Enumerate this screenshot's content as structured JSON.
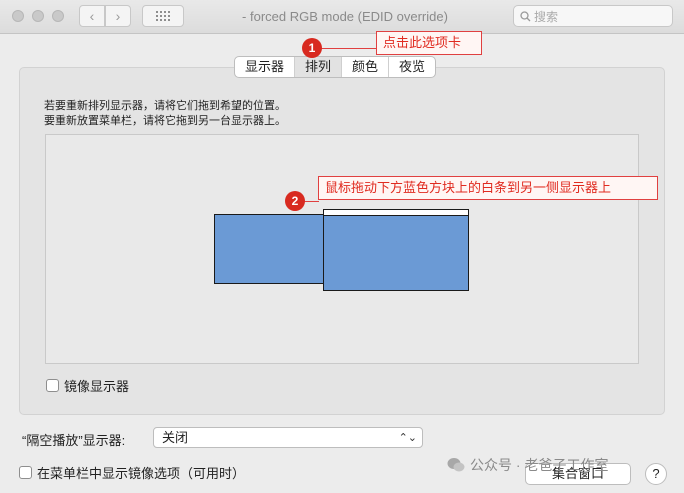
{
  "window": {
    "title": "- forced RGB mode (EDID override)",
    "search_placeholder": "搜索"
  },
  "tabs": [
    {
      "label": "显示器"
    },
    {
      "label": "排列",
      "active": true
    },
    {
      "label": "颜色"
    },
    {
      "label": "夜览"
    }
  ],
  "instructions": {
    "line1": "若要重新排列显示器，请将它们拖到希望的位置。",
    "line2": "要重新放置菜单栏，请将它拖到另一台显示器上。"
  },
  "mirror": {
    "label": "镜像显示器",
    "checked": false
  },
  "airplay": {
    "label": "“隔空播放”显示器:",
    "value": "关闭"
  },
  "menubar_option": {
    "label": "在菜单栏中显示镜像选项（可用时）",
    "checked": false
  },
  "buttons": {
    "gather": "集合窗口",
    "help": "?"
  },
  "annotations": {
    "step1_number": "1",
    "step1_text": "点击此选项卡",
    "step2_number": "2",
    "step2_text": "鼠标拖动下方蓝色方块上的白条到另一侧显示器上"
  },
  "watermark": {
    "text": "公众号 · 老爸子工作室"
  },
  "colors": {
    "display_fill": "#6b9ad5",
    "annotation_red": "#d82a20",
    "window_bg": "#ececec"
  }
}
